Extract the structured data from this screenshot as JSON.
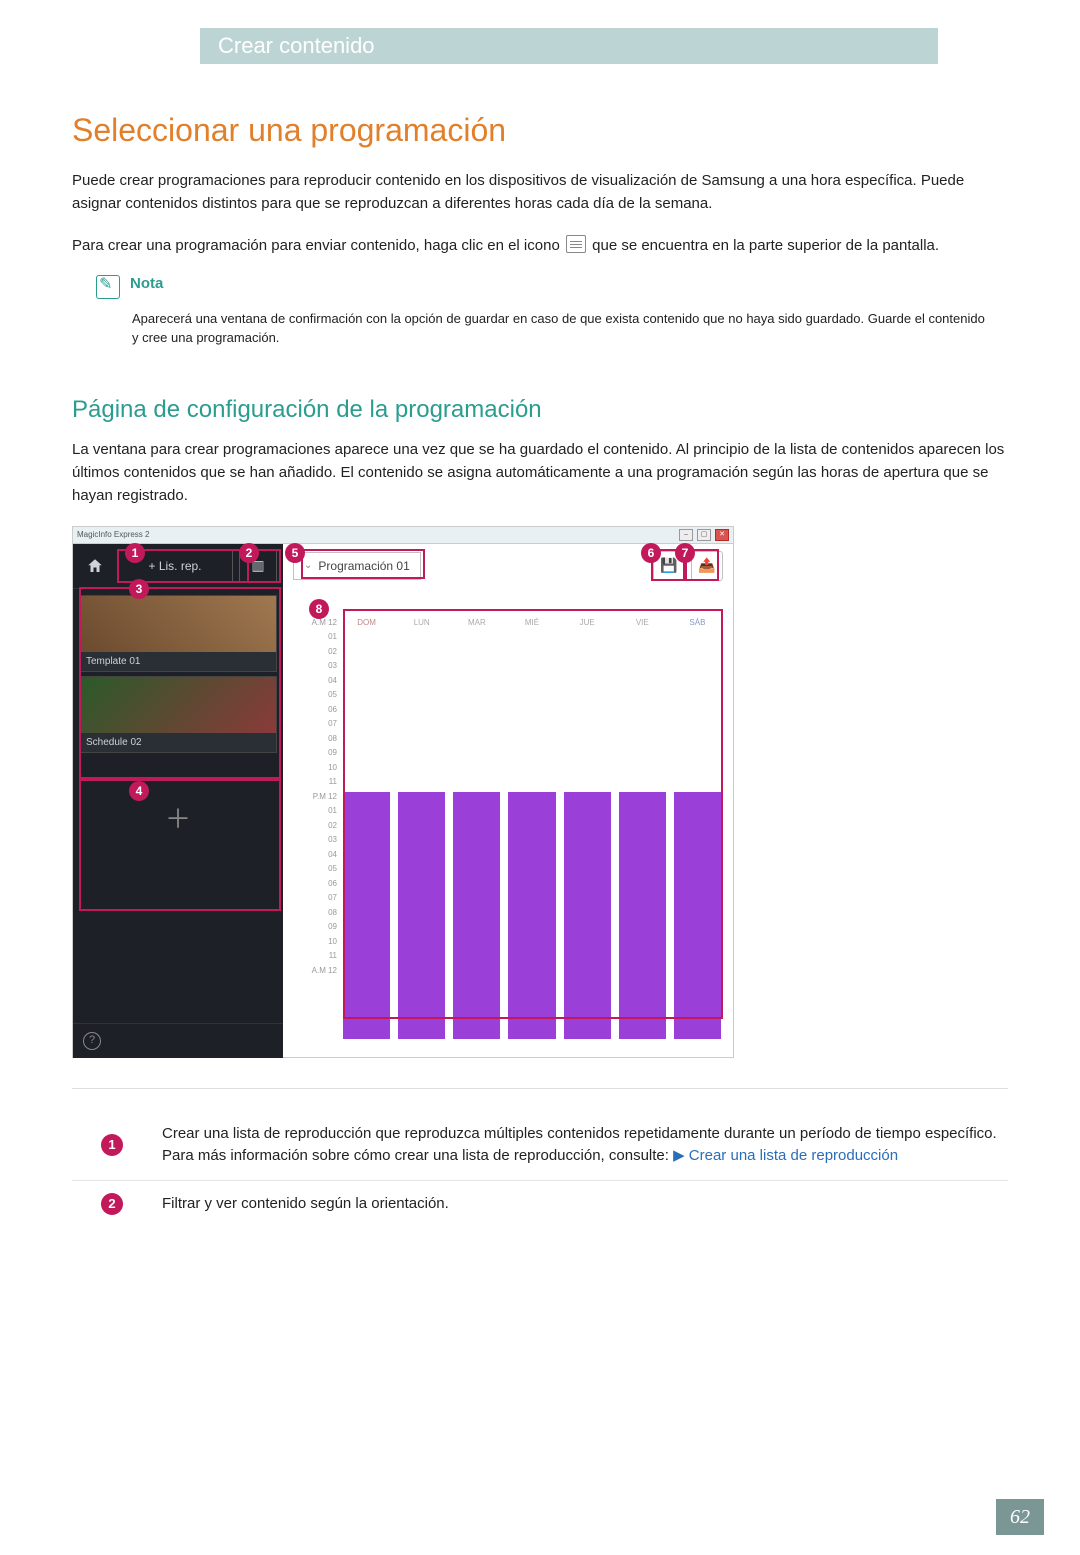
{
  "breadcrumb": "Crear contenido",
  "heading1": "Seleccionar una programación",
  "para1": "Puede crear programaciones para reproducir contenido en los dispositivos de visualización de Samsung a una hora específica. Puede asignar contenidos distintos para que se reproduzcan a diferentes horas cada día de la semana.",
  "para2_pre": "Para crear una programación para enviar contenido, haga clic en el icono ",
  "para2_post": " que se encuentra en la parte superior de la pantalla.",
  "note_label": "Nota",
  "note_body": "Aparecerá una ventana de confirmación con la opción de guardar en caso de que exista contenido que no haya sido guardado. Guarde el contenido y cree una programación.",
  "heading2": "Página de configuración de la programación",
  "para3": "La ventana para crear programaciones aparece una vez que se ha guardado el contenido. Al principio de la lista de contenidos aparecen los últimos contenidos que se han añadido. El contenido se asigna automáticamente a una programación según las horas de apertura que se hayan registrado.",
  "app": {
    "window_title": "MagicInfo Express 2",
    "sidebar": {
      "playlist_btn": "+  Lis. rep.",
      "card1": "Template 01",
      "card2": "Schedule 02"
    },
    "toolbar": {
      "schedule_name": "Programación 01"
    },
    "days": [
      "DOM",
      "LUN",
      "MAR",
      "MIÉ",
      "JUE",
      "VIE",
      "SÁB"
    ],
    "time_rows": [
      "A.M 12",
      "01",
      "02",
      "03",
      "04",
      "05",
      "06",
      "07",
      "08",
      "09",
      "10",
      "11",
      "P.M 12",
      "01",
      "02",
      "03",
      "04",
      "05",
      "06",
      "07",
      "08",
      "09",
      "10",
      "11",
      "A.M 12"
    ]
  },
  "callouts": [
    "1",
    "2",
    "3",
    "4",
    "5",
    "6",
    "7",
    "8"
  ],
  "legend": {
    "row1_text": "Crear una lista de reproducción que reproduzca múltiples contenidos repetidamente durante un período de tiempo específico. Para más información sobre cómo crear una lista de reproducción, consulte:  ",
    "row1_link": "▶ Crear una lista de reproducción",
    "row2_text": "Filtrar y ver contenido según la orientación."
  },
  "page_number": "62"
}
